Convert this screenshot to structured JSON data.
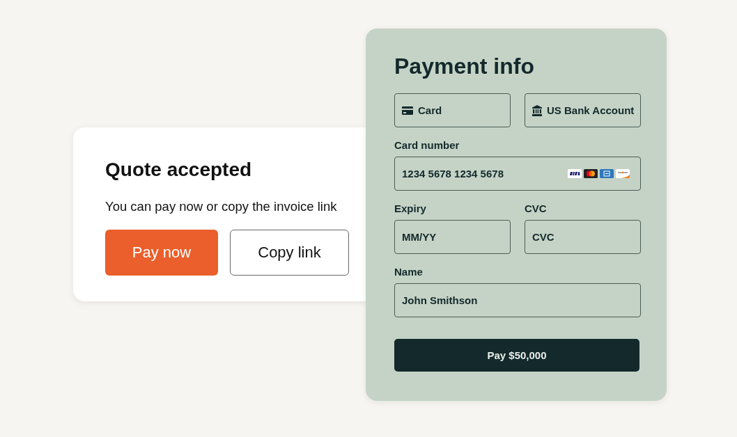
{
  "quote_card": {
    "title": "Quote accepted",
    "message": "You can pay now or copy the invoice link",
    "buttons": [
      {
        "label": "Pay now",
        "kind": "primary"
      },
      {
        "label": "Copy link",
        "kind": "secondary"
      }
    ]
  },
  "payment_panel": {
    "title": "Payment info",
    "methods": [
      {
        "label": "Card",
        "kind": "card",
        "selected": false
      },
      {
        "label": "US Bank Account",
        "kind": "bank",
        "selected": false
      }
    ],
    "card_number": {
      "label": "Card number",
      "value": "1234 5678 1234 5678"
    },
    "expiry": {
      "label": "Expiry",
      "placeholder": "MM/YY"
    },
    "cvc": {
      "label": "CVC",
      "placeholder": "CVC"
    },
    "name": {
      "label": "Name",
      "value": "John Smithson"
    },
    "submit_button": "Pay $50,000"
  }
}
